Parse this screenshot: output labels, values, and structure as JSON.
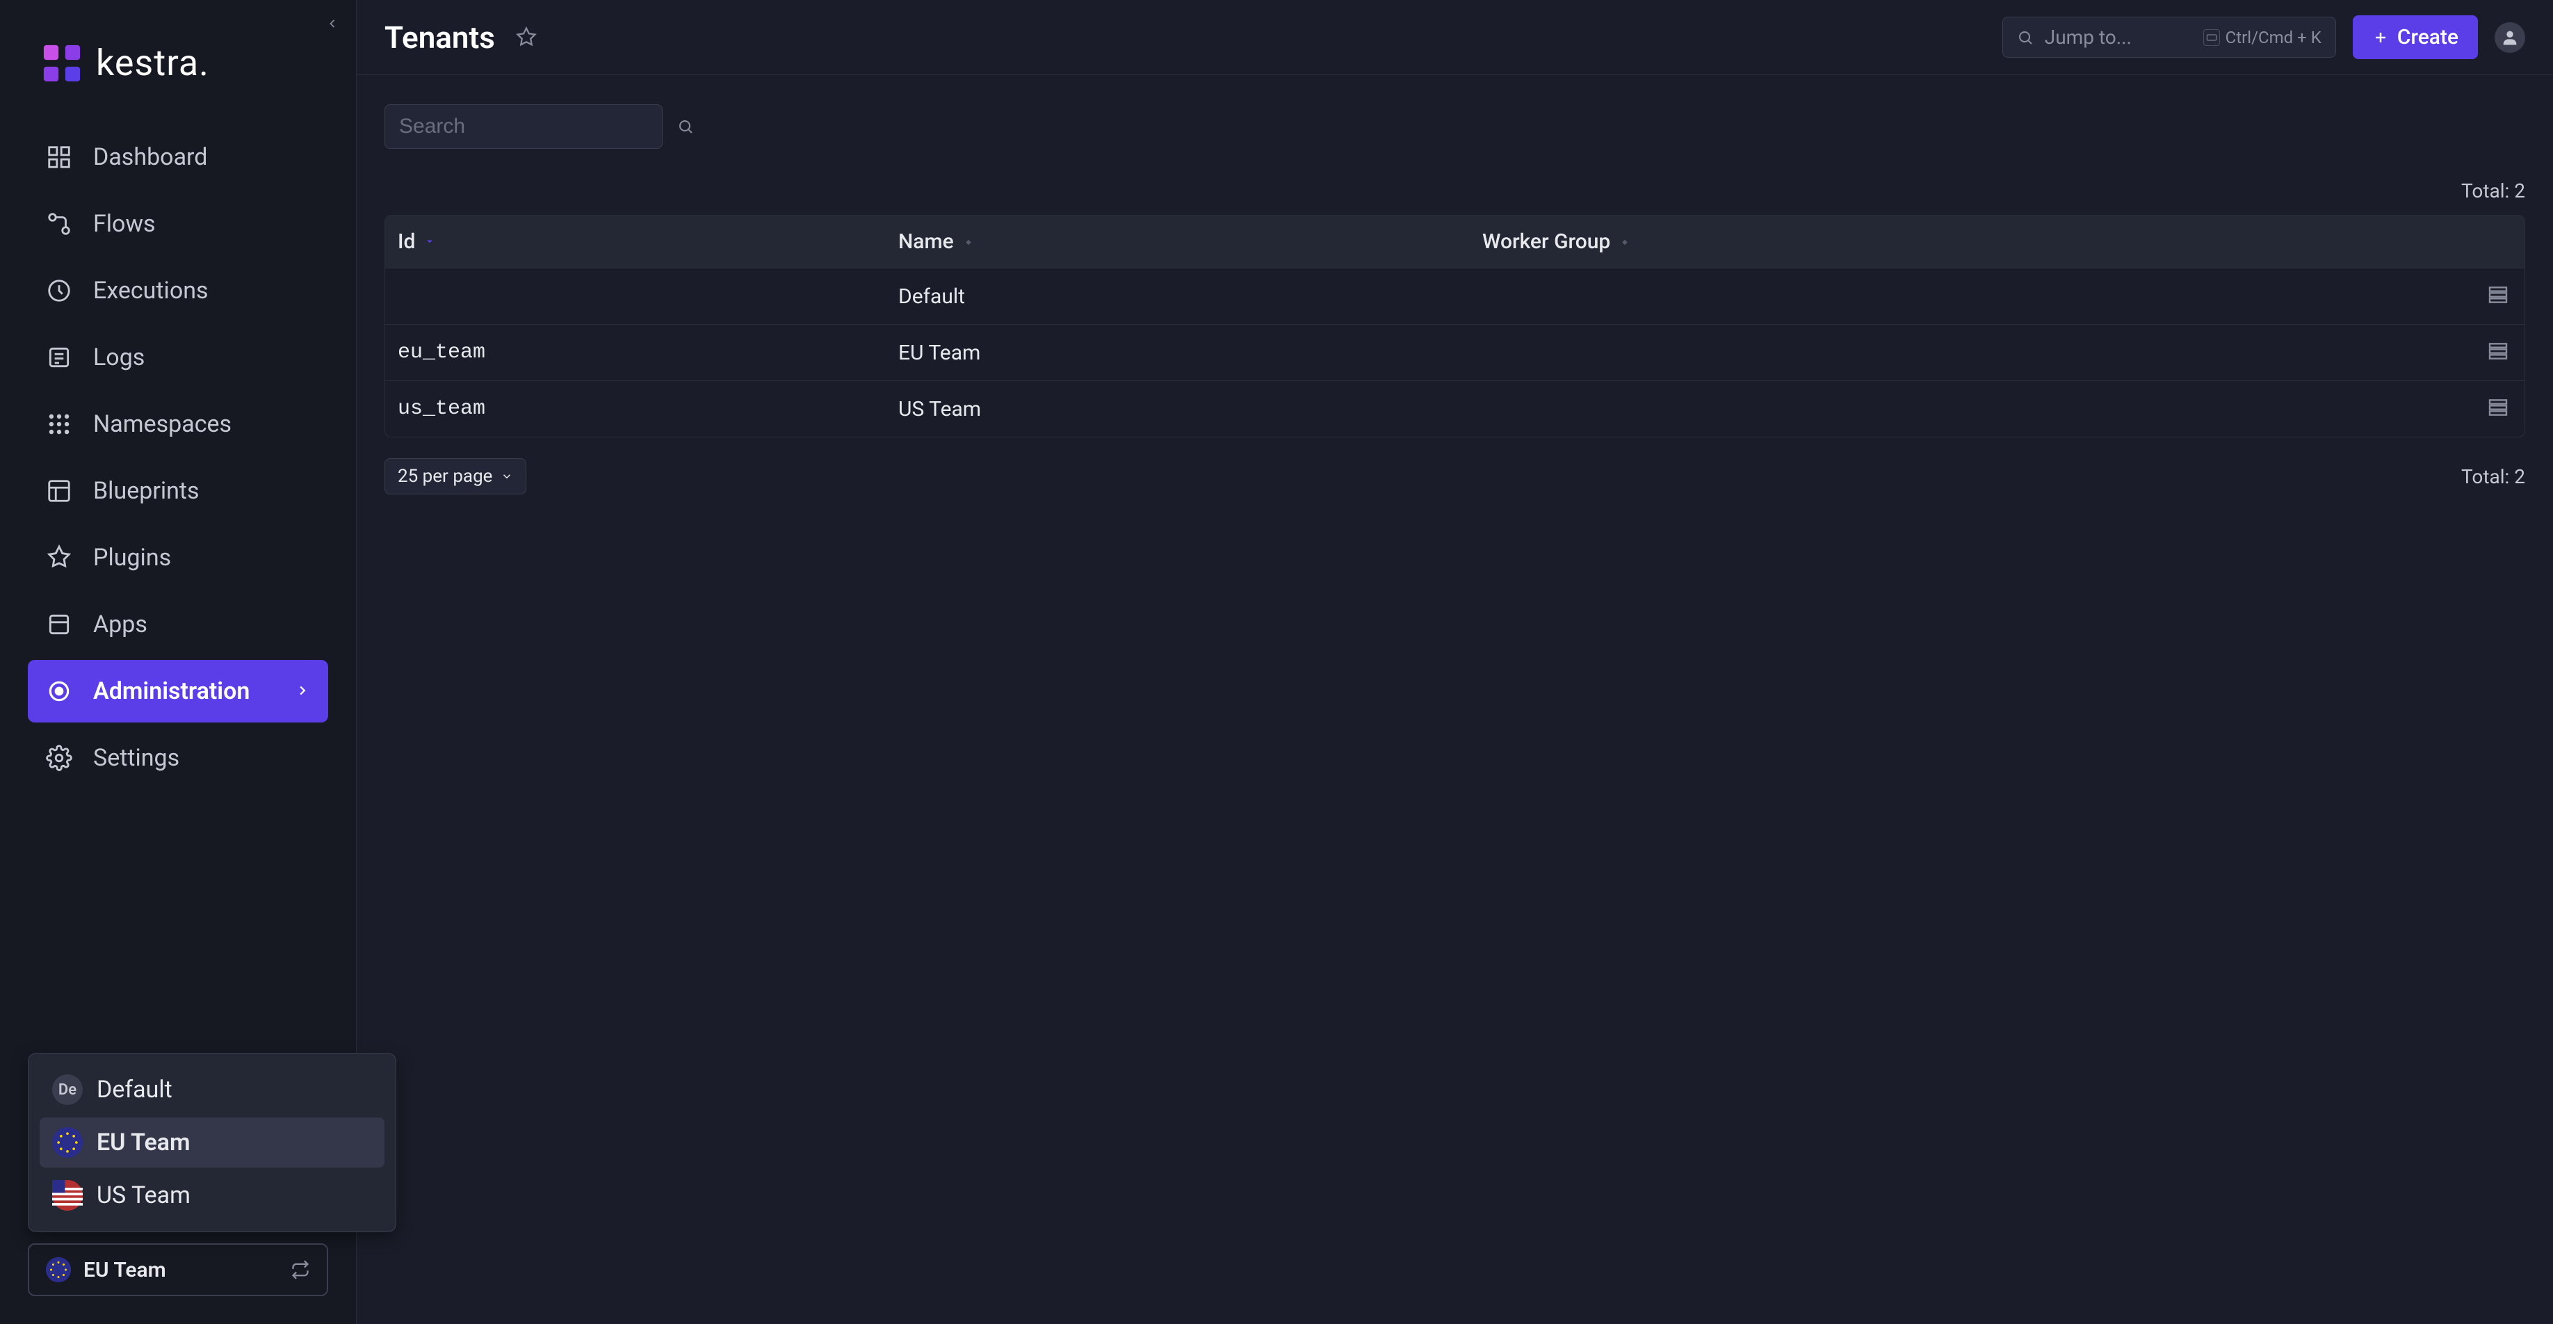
{
  "brand": {
    "name": "kestra."
  },
  "sidebar": {
    "items": [
      {
        "label": "Dashboard"
      },
      {
        "label": "Flows"
      },
      {
        "label": "Executions"
      },
      {
        "label": "Logs"
      },
      {
        "label": "Namespaces"
      },
      {
        "label": "Blueprints"
      },
      {
        "label": "Plugins"
      },
      {
        "label": "Apps"
      },
      {
        "label": "Administration"
      },
      {
        "label": "Settings"
      }
    ],
    "active_index": 8
  },
  "tenant_switcher": {
    "current": "EU Team",
    "options": [
      {
        "label": "Default",
        "avatar_text": "De",
        "avatar_class": "avatar-de"
      },
      {
        "label": "EU Team",
        "avatar_text": "",
        "avatar_class": "avatar-eu"
      },
      {
        "label": "US Team",
        "avatar_text": "",
        "avatar_class": "avatar-us"
      }
    ],
    "selected_index": 1
  },
  "header": {
    "title": "Tenants",
    "jump_placeholder": "Jump to...",
    "kbd_label": "Ctrl/Cmd + K",
    "create_label": "Create"
  },
  "filters": {
    "search_placeholder": "Search"
  },
  "totals": {
    "top": "Total: 2",
    "bottom": "Total: 2"
  },
  "table": {
    "columns": [
      "Id",
      "Name",
      "Worker Group"
    ],
    "rows": [
      {
        "id": "",
        "name": "Default",
        "worker_group": ""
      },
      {
        "id": "eu_team",
        "name": "EU Team",
        "worker_group": ""
      },
      {
        "id": "us_team",
        "name": "US Team",
        "worker_group": ""
      }
    ]
  },
  "pagination": {
    "per_page": "25 per page"
  },
  "colors": {
    "accent": "#5b3ee8",
    "bg": "#1a1d29",
    "panel": "#232636"
  }
}
